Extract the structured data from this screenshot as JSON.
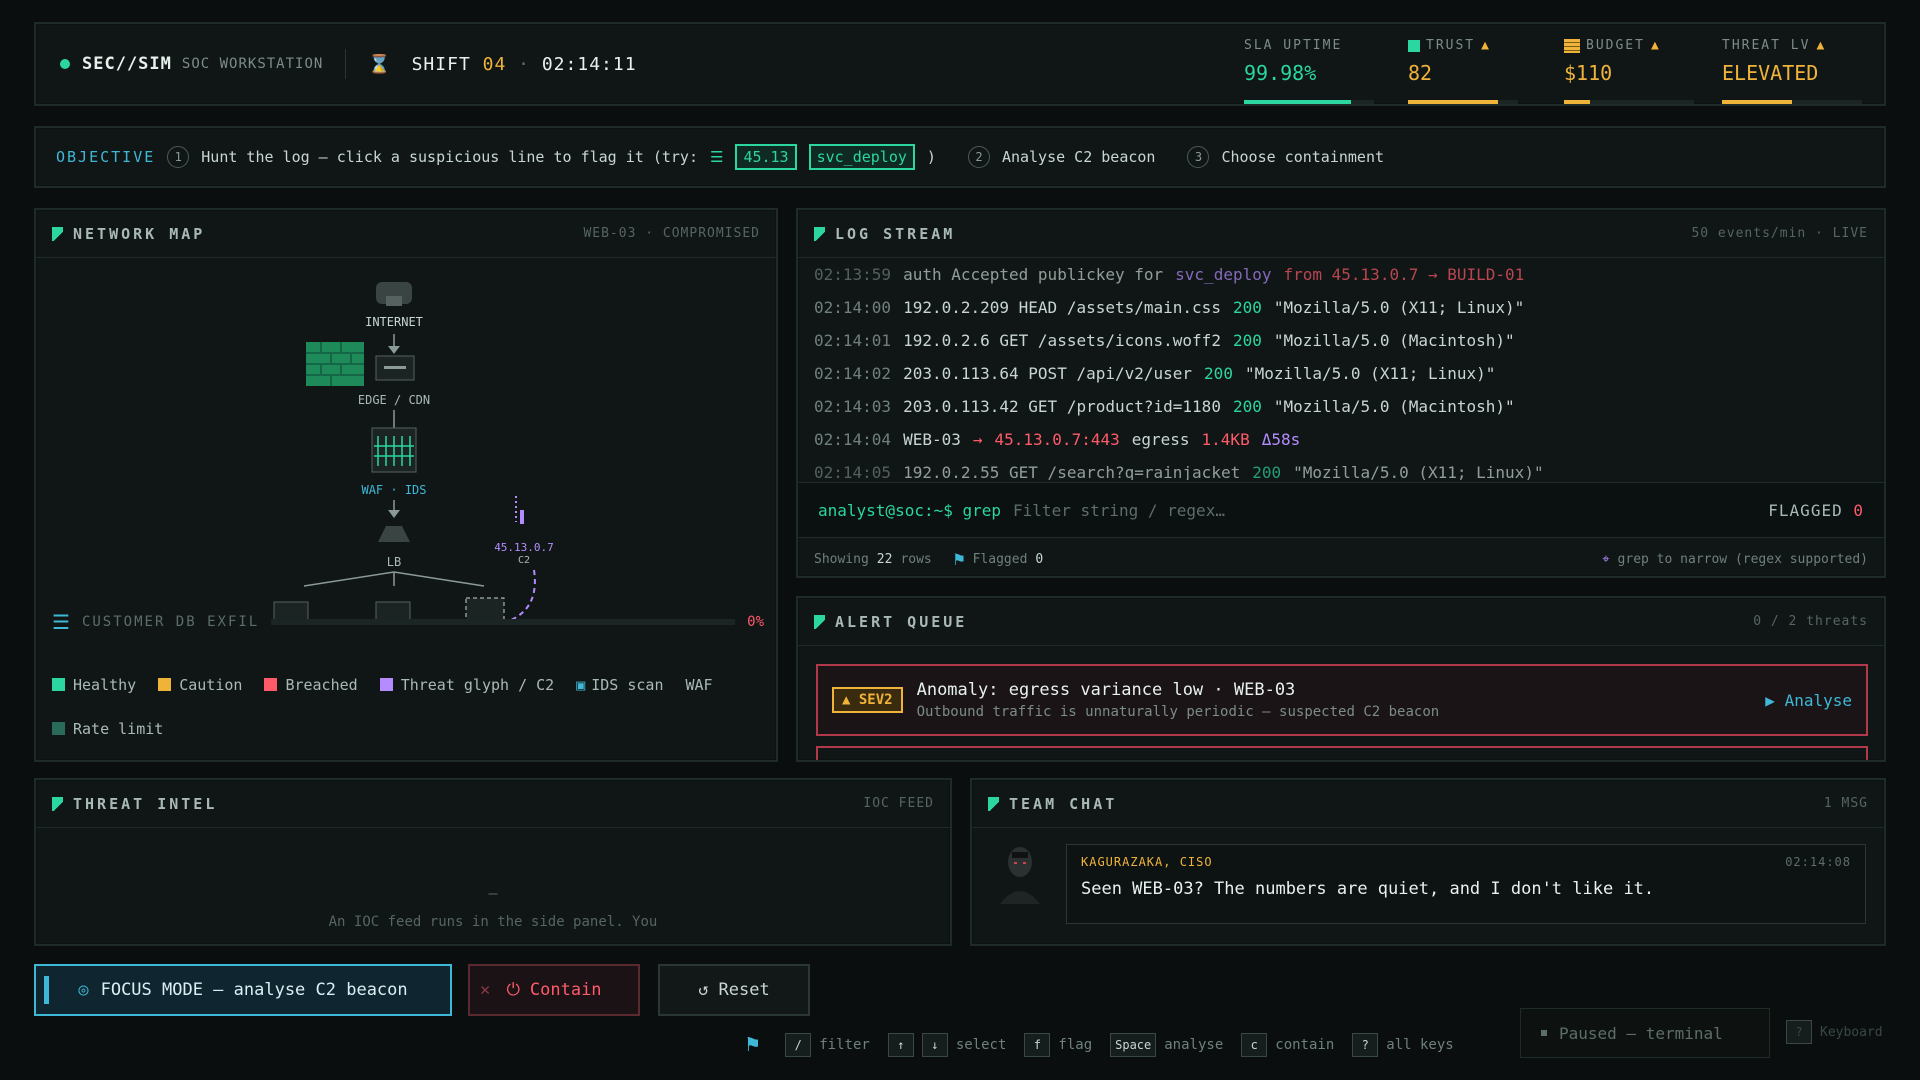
{
  "topbar": {
    "brand": "SEC//SIM",
    "subtitle": "SOC WORKSTATION",
    "shift_label": "SHIFT",
    "shift_num": "04",
    "clock": "02:14:11",
    "stats": [
      {
        "label": "SLA UPTIME",
        "value": "99.98%",
        "warn": false,
        "level": 0.82,
        "color": "#2bd6a0"
      },
      {
        "label": "TRUST",
        "value": "82",
        "warn": true,
        "level": 0.82,
        "color": "#f0b33a"
      },
      {
        "label": "BUDGET",
        "value": "$110",
        "warn": true,
        "level": 0.2,
        "color": "#f0b33a"
      },
      {
        "label": "THREAT LV",
        "value": "ELEVATED",
        "warn": true,
        "level": 0.5,
        "color": "#f0b33a"
      }
    ]
  },
  "objective": {
    "label": "OBJECTIVE",
    "step1": "Hunt the log — click a suspicious line to flag it (try:",
    "chip1": "45.13",
    "chip2": "svc_deploy",
    "step1_end": ")",
    "step2": "Analyse C2 beacon",
    "step3": "Choose containment"
  },
  "netmap": {
    "title": "NETWORK MAP",
    "meta": "WEB-03 · COMPROMISED",
    "nodes": {
      "internet": "INTERNET",
      "edge": "EDGE / CDN",
      "waf": "WAF · IDS",
      "lb": "LB",
      "c2_ip": "45.13.0.7",
      "c2": "C2"
    },
    "exfil_label": "CUSTOMER DB EXFIL",
    "exfil_pct": "0%",
    "legend": {
      "healthy": "Healthy",
      "caution": "Caution",
      "breached": "Breached",
      "threat": "Threat glyph / C2",
      "ids": "IDS scan",
      "waf": "WAF",
      "rate": "Rate limit"
    }
  },
  "logstream": {
    "title": "LOG STREAM",
    "meta": "50 events/min · LIVE",
    "lines": [
      {
        "ts": "02:13:59",
        "a": "auth Accepted publickey for",
        "user": "svc_deploy",
        "b": "from 45.13.0.7 → BUILD-01",
        "c": ""
      },
      {
        "ts": "02:14:00",
        "a": "192.0.2.209 HEAD /assets/main.css",
        "code": "200",
        "ua": "\"Mozilla/5.0 (X11; Linux)\""
      },
      {
        "ts": "02:14:01",
        "a": "192.0.2.6 GET /assets/icons.woff2",
        "code": "200",
        "ua": "\"Mozilla/5.0 (Macintosh)\""
      },
      {
        "ts": "02:14:02",
        "a": "203.0.113.64 POST /api/v2/user",
        "code": "200",
        "ua": "\"Mozilla/5.0 (X11; Linux)\""
      },
      {
        "ts": "02:14:03",
        "a": "203.0.113.42 GET /product?id=1180",
        "code": "200",
        "ua": "\"Mozilla/5.0 (Macintosh)\""
      },
      {
        "ts": "02:14:04",
        "a": "WEB-03",
        "arrow": "→",
        "dst": "45.13.0.7:443",
        "mid": "egress",
        "size": "1.4KB",
        "delta": "Δ58s"
      },
      {
        "ts": "02:14:05",
        "a": "192.0.2.55 GET /search?q=rainjacket",
        "code": "200",
        "ua": "\"Mozilla/5.0 (X11; Linux)\""
      }
    ],
    "prompt": "analyst@soc:~$ grep",
    "placeholder": "Filter string / regex…",
    "flagged_label": "FLAGGED",
    "flagged_count": "0",
    "showing_a": "Showing",
    "showing_n": "22",
    "showing_b": "rows",
    "flagged_small": "Flagged",
    "flagged_small_n": "0",
    "hint": "grep to narrow (regex supported)"
  },
  "alerts": {
    "title": "ALERT QUEUE",
    "meta": "0 / 2 threats",
    "card": {
      "sev": "SEV2",
      "title": "Anomaly: egress variance low · WEB-03",
      "desc": "Outbound traffic is unnaturally periodic — suspected C2 beacon",
      "action": "Analyse"
    }
  },
  "intel": {
    "title": "THREAT INTEL",
    "meta": "IOC FEED",
    "dash": "—",
    "body": "An IOC feed runs in the side panel. You"
  },
  "chat": {
    "title": "TEAM CHAT",
    "meta": "1 MSG",
    "sender": "KAGURAZAKA, CISO",
    "time": "02:14:08",
    "message": "Seen WEB-03? The numbers are quiet, and I don't like it."
  },
  "bottom": {
    "focus": "FOCUS MODE — analyse C2 beacon",
    "contain": "Contain",
    "reset": "Reset",
    "paused": "Paused — terminal",
    "keyboard": "Keyboard",
    "hints": [
      {
        "key": "/",
        "label": "filter"
      },
      {
        "key": "↑",
        "key2": "↓",
        "label": "select"
      },
      {
        "key": "f",
        "label": "flag"
      },
      {
        "key": "Space",
        "label": "analyse"
      },
      {
        "key": "c",
        "label": "contain"
      },
      {
        "key": "?",
        "label": "all keys"
      }
    ]
  },
  "colors": {
    "accent": "#2bd6a0",
    "warn": "#f0b33a",
    "danger": "#ff5a6a",
    "threat": "#b48cff"
  }
}
